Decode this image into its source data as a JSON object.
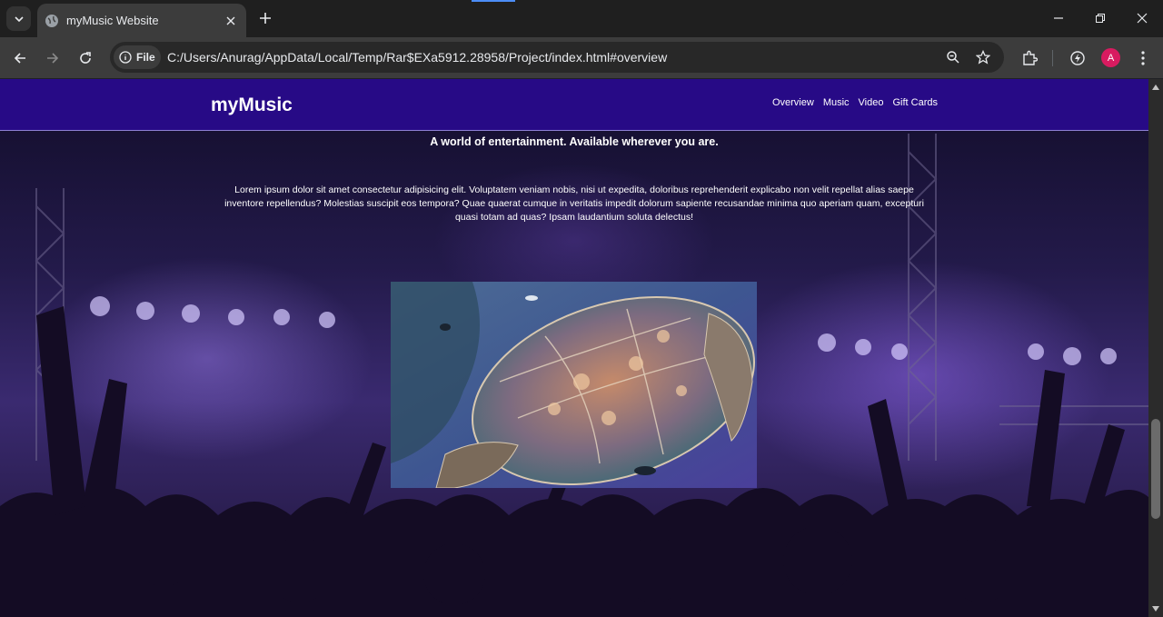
{
  "browser": {
    "tab_title": "myMusic Website",
    "file_chip": "File",
    "url": "C:/Users/Anurag/AppData/Local/Temp/Rar$EXa5912.28958/Project/index.html#overview",
    "profile_initial": "A",
    "icons": [
      "tab-search-icon",
      "globe-icon",
      "close-icon",
      "plus-icon",
      "minimize-icon",
      "restore-icon",
      "close-window-icon",
      "back-icon",
      "forward-icon",
      "reload-icon",
      "info-icon",
      "zoom-icon",
      "star-icon",
      "extensions-icon",
      "performance-icon",
      "menu-icon"
    ]
  },
  "site": {
    "logo": "myMusic",
    "nav": [
      "Overview",
      "Music",
      "Video",
      "Gift Cards"
    ],
    "tagline": "A world of entertainment. Available wherever you are.",
    "body_text": "Lorem ipsum dolor sit amet consectetur adipisicing elit. Voluptatem veniam nobis, nisi ut expedita, doloribus reprehenderit explicabo non velit repellat alias saepe inventore repellendus? Molestias suscipit eos tempora? Quae quaerat cumque in veritatis impedit dolorum sapiente recusandae minima quo aperiam quam, excepturi quasi totam ad quas? Ipsam laudantium soluta delectus!",
    "image_subject": "sea turtle",
    "colors": {
      "nav_bg": "#270a86",
      "page_bg": "#231a4a"
    }
  }
}
